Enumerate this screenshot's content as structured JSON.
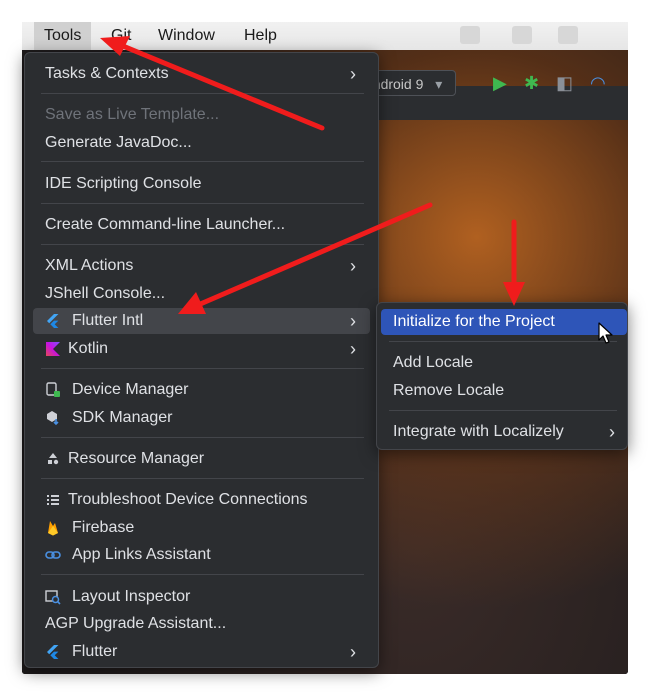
{
  "menubar": {
    "items": [
      "Tools",
      "Git",
      "Window",
      "Help"
    ],
    "active": "Tools"
  },
  "toolbar": {
    "device": "android 9",
    "device_chevron": "▾"
  },
  "tools_menu": {
    "tasks_contexts": "Tasks & Contexts",
    "save_live_template": "Save as Live Template...",
    "generate_javadoc": "Generate JavaDoc...",
    "ide_scripting_console": "IDE Scripting Console",
    "create_cli_launcher": "Create Command-line Launcher...",
    "xml_actions": "XML Actions",
    "jshell_console": "JShell Console...",
    "flutter_intl": "Flutter Intl",
    "kotlin": "Kotlin",
    "device_manager": "Device Manager",
    "sdk_manager": "SDK Manager",
    "resource_manager": "Resource Manager",
    "troubleshoot": "Troubleshoot Device Connections",
    "firebase": "Firebase",
    "app_links": "App Links Assistant",
    "layout_inspector": "Layout Inspector",
    "agp_upgrade": "AGP Upgrade Assistant...",
    "flutter": "Flutter",
    "submenu_arrow": "›"
  },
  "flutter_intl_submenu": {
    "initialize": "Initialize for the Project",
    "add_locale": "Add Locale",
    "remove_locale": "Remove Locale",
    "integrate_localizely": "Integrate with Localizely"
  },
  "colors": {
    "menu_bg": "#2b2d30",
    "selected": "#2e55b8",
    "annotation": "#f01c1c"
  },
  "icons": {
    "flutter": "flutter-logo",
    "kotlin": "kotlin-logo",
    "device_manager": "device-manager-icon",
    "sdk_manager": "sdk-manager-icon",
    "resource_manager": "resource-manager-icon",
    "troubleshoot": "list-icon",
    "firebase": "firebase-flame-icon",
    "app_links": "link-icon",
    "layout_inspector": "layout-inspector-icon"
  }
}
